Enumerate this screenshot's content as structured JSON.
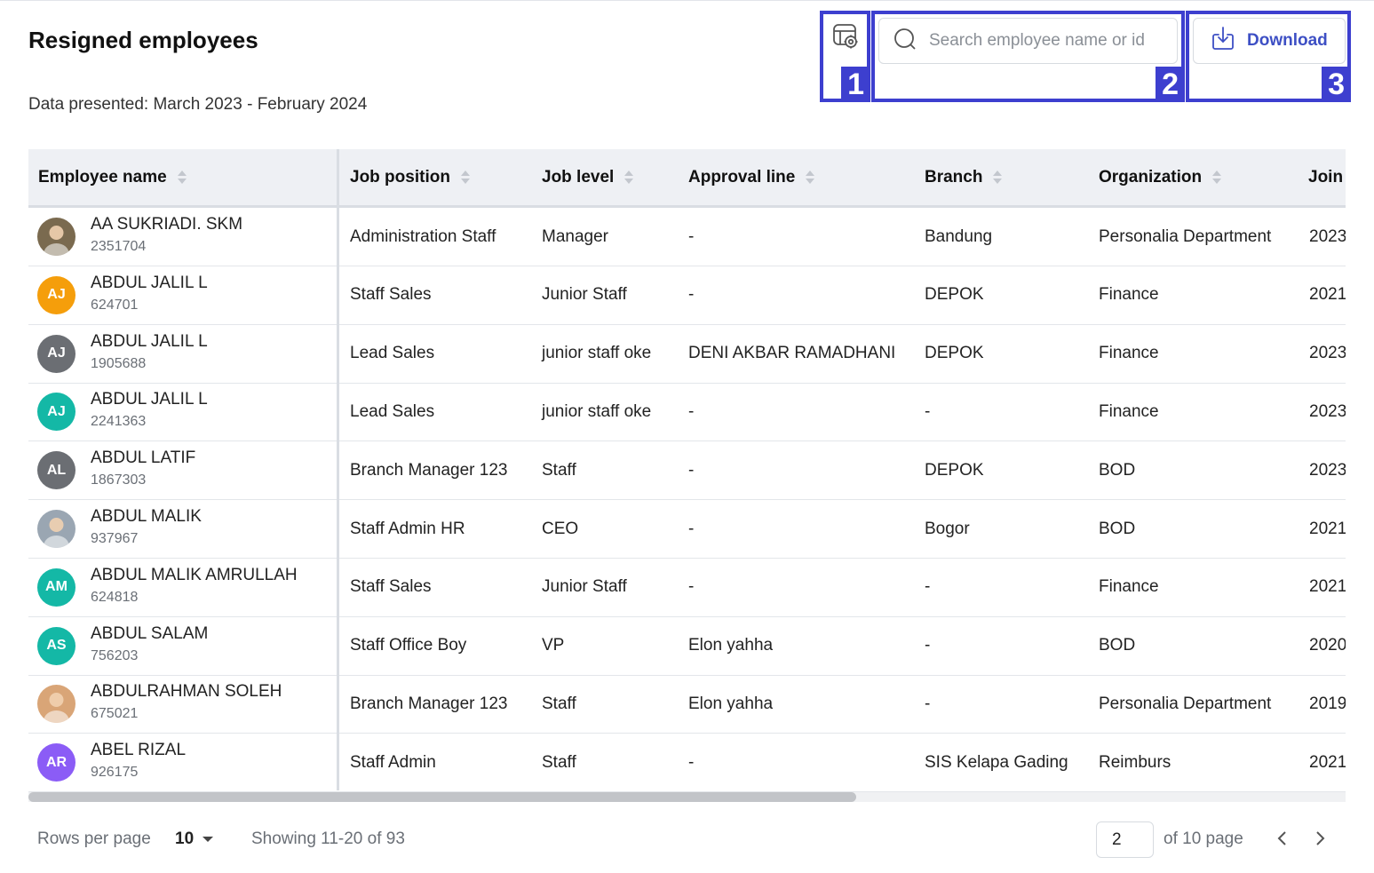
{
  "page": {
    "title": "Resigned employees",
    "subtitle": "Data presented: March 2023 - February 2024"
  },
  "toolbar": {
    "settings_icon": "table-settings-icon",
    "settings_tag": "1",
    "search_placeholder": "Search employee name or id",
    "search_tag": "2",
    "download_label": "Download",
    "download_tag": "3"
  },
  "table": {
    "columns": [
      "Employee name",
      "Job position",
      "Job level",
      "Approval line",
      "Branch",
      "Organization",
      "Join"
    ],
    "rows": [
      {
        "name": "AA SUKRIADI. SKM",
        "id": "2351704",
        "initials": "",
        "avatar": "photo",
        "avatar_color": "#7a6a4f",
        "job_position": "Administration Staff",
        "job_level": "Manager",
        "approval_line": "-",
        "branch": "Bandung",
        "organization": "Personalia Department",
        "join": "2023"
      },
      {
        "name": "ABDUL JALIL L",
        "id": "624701",
        "initials": "AJ",
        "avatar": "initials",
        "avatar_color": "#f59e0b",
        "job_position": "Staff Sales",
        "job_level": "Junior Staff",
        "approval_line": "-",
        "branch": "DEPOK",
        "organization": "Finance",
        "join": "2021"
      },
      {
        "name": "ABDUL JALIL L",
        "id": "1905688",
        "initials": "AJ",
        "avatar": "initials",
        "avatar_color": "#6b6e73",
        "job_position": "Lead Sales",
        "job_level": "junior staff oke",
        "approval_line": "DENI AKBAR RAMADHANI",
        "branch": "DEPOK",
        "organization": "Finance",
        "join": "2023"
      },
      {
        "name": "ABDUL JALIL L",
        "id": "2241363",
        "initials": "AJ",
        "avatar": "initials",
        "avatar_color": "#14b8a6",
        "job_position": "Lead Sales",
        "job_level": "junior staff oke",
        "approval_line": "-",
        "branch": "-",
        "organization": "Finance",
        "join": "2023"
      },
      {
        "name": "ABDUL LATIF",
        "id": "1867303",
        "initials": "AL",
        "avatar": "initials",
        "avatar_color": "#6b6e73",
        "job_position": "Branch Manager 123",
        "job_level": "Staff",
        "approval_line": "-",
        "branch": "DEPOK",
        "organization": "BOD",
        "join": "2023"
      },
      {
        "name": "ABDUL MALIK",
        "id": "937967",
        "initials": "",
        "avatar": "photo",
        "avatar_color": "#9aa6b2",
        "job_position": "Staff Admin HR",
        "job_level": "CEO",
        "approval_line": "-",
        "branch": "Bogor",
        "organization": "BOD",
        "join": "2021"
      },
      {
        "name": "ABDUL MALIK AMRULLAH",
        "id": "624818",
        "initials": "AM",
        "avatar": "initials",
        "avatar_color": "#14b8a6",
        "job_position": "Staff Sales",
        "job_level": "Junior Staff",
        "approval_line": "-",
        "branch": "-",
        "organization": "Finance",
        "join": "2021"
      },
      {
        "name": "ABDUL SALAM",
        "id": "756203",
        "initials": "AS",
        "avatar": "initials",
        "avatar_color": "#14b8a6",
        "job_position": "Staff Office Boy",
        "job_level": "VP",
        "approval_line": "Elon yahha",
        "branch": "-",
        "organization": "BOD",
        "join": "2020"
      },
      {
        "name": "ABDULRAHMAN SOLEH",
        "id": "675021",
        "initials": "",
        "avatar": "photo",
        "avatar_color": "#d9a577",
        "job_position": "Branch Manager 123",
        "job_level": "Staff",
        "approval_line": "Elon yahha",
        "branch": "-",
        "organization": "Personalia Department",
        "join": "2019"
      },
      {
        "name": "ABEL RIZAL",
        "id": "926175",
        "initials": "AR",
        "avatar": "initials",
        "avatar_color": "#8b5cf6",
        "job_position": "Staff Admin",
        "job_level": "Staff",
        "approval_line": "-",
        "branch": "SIS Kelapa Gading",
        "organization": "Reimburs",
        "join": "2021"
      }
    ]
  },
  "footer": {
    "rows_per_page_label": "Rows per page",
    "rows_per_page_value": "10",
    "showing": "Showing 11-20 of 93",
    "page_value": "2",
    "of_pages": "of 10 page",
    "prev_icon": "chevron-left-icon",
    "next_icon": "chevron-right-icon"
  },
  "colors": {
    "accent": "#3d3fcf",
    "link": "#3d4fc4",
    "header_bg": "#eef0f4"
  }
}
